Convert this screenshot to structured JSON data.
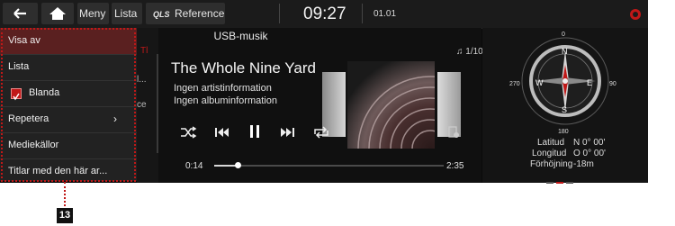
{
  "topbar": {
    "menu_label": "Meny",
    "list_label": "Lista",
    "logo_text": "QLS",
    "reference_label": "Reference",
    "time": "09:27",
    "date": "01.01"
  },
  "media": {
    "source_title": "USB-musik",
    "track_count": "1/10",
    "song_title": "The Whole Nine Yard:",
    "artist": "Ingen artistinformation",
    "album": "Ingen albuminformation",
    "elapsed": "0:14",
    "duration": "2:35",
    "progress": 0.1,
    "list_peek": [
      "Tl",
      "l...",
      "ce"
    ]
  },
  "menu": {
    "items": [
      {
        "label": "Visa av"
      },
      {
        "label": "Lista"
      },
      {
        "label": "Blanda",
        "checked": true
      },
      {
        "label": "Repetera",
        "has_submenu": true
      },
      {
        "label": "Mediekällor"
      },
      {
        "label": "Titlar med den här ar..."
      }
    ]
  },
  "compass": {
    "N": "N",
    "E": "E",
    "S": "S",
    "W": "W",
    "deg_0": "0",
    "deg_90": "90",
    "deg_180": "180",
    "deg_270": "270"
  },
  "geo": {
    "lat_label": "Latitud",
    "lat_value": "N 0° 00'",
    "lon_label": "Longitud",
    "lon_value": "O 0° 00'",
    "alt_label": "Förhöjning",
    "alt_value": "-18m"
  },
  "callout_number": "13",
  "colors": {
    "accent_red": "#c01818",
    "active_menu": "#5a2020"
  }
}
